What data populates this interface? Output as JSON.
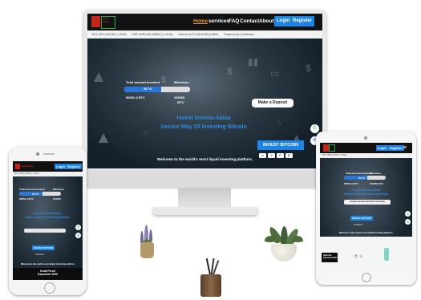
{
  "monitor": {
    "brand_line1": "Invest",
    "brand_line2": "Salsa",
    "nav": {
      "home": "Home",
      "services": "services",
      "faq": "FAQ",
      "contact": "Contact",
      "about": "About",
      "login": "Login",
      "register": "Register"
    },
    "ticker": [
      "BTC (BTC) $9.36 (-1.15%)",
      "XRP (XRP) $0.495514 (-1.91%)",
      "Litecoin (LTC) $134.55 (2.68%)",
      "Powered by CoinGecko"
    ],
    "hero": {
      "total_label": "Total amount invested",
      "milestone_label": "Milestone",
      "progress_label": "56.7%",
      "progress_fraction": 0.567,
      "total_value": "56651.3 BTC",
      "milestone_value": "100000",
      "milestone_unit": "BTC",
      "title_line1": "Invest Investa-Salsa",
      "title_line2": "Secure Way Of Investing Bitcoin",
      "deposit_label": "Make a Deposit",
      "invest_label": "INVEST BITCOIN",
      "pay_icons": [
        "card-icon",
        "visa-icon",
        "paypal-icon",
        "bitcoin-icon"
      ],
      "footer": "Welcome to the world's most liquid investing platform."
    }
  },
  "phone": {
    "brand": "Invest Salsa",
    "login": "Login",
    "register": "Register",
    "total_label": "Total amount invested",
    "milestone_label": "Milestone",
    "progress_label": "56.7%",
    "progress_fraction": 0.567,
    "total_value": "56651.3 BTC",
    "milestone_value": "100000",
    "title_line1": "Invest Investa-Salsa",
    "title_line2": "Secure Way Of Investing Bitcoin",
    "invest_label": "INVEST BITCOIN",
    "footer": "Welcome to the world's most liquid investing platform.",
    "popup_line1": "Kmal Permi",
    "popup_line2": "Deposited 1000"
  },
  "tablet": {
    "login": "Login",
    "register": "Register",
    "total_label": "Total amount invested",
    "milestone_label": "Milestone",
    "progress_label": "56.7%",
    "progress_fraction": 0.567,
    "total_value": "56651.3 BTC",
    "milestone_value": "100000 BTC",
    "title_line1": "Invest Investa-Salsa",
    "title_line2": "Secure Way Of Investing Bitcoin",
    "deposit_label": "Create Account and Start Investing",
    "invest_label": "INVEST BITCOIN",
    "footer": "Welcome to the world's most liquid investing platform.",
    "popup_line1": "Noah Mo...",
    "popup_line2": "Deposited $212"
  },
  "colors": {
    "accent_blue": "#1b84e6",
    "nav_active": "#f39c12",
    "brand_red": "#c0261c",
    "brand_green": "#2fa84a",
    "title_blue": "#2e8de8"
  }
}
